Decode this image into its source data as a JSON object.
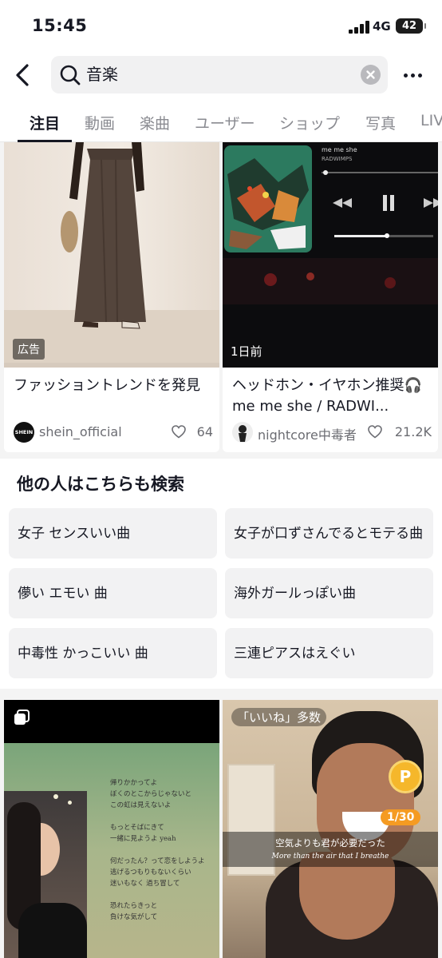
{
  "status_bar": {
    "time": "15:45",
    "network": "4G",
    "battery": "42"
  },
  "search": {
    "query": "音楽",
    "icons": {
      "back": "chevron-left-icon",
      "search": "search-icon",
      "clear": "clear-icon",
      "more": "more-icon"
    }
  },
  "tabs": [
    {
      "label": "注目",
      "active": true
    },
    {
      "label": "動画",
      "active": false
    },
    {
      "label": "楽曲",
      "active": false
    },
    {
      "label": "ユーザー",
      "active": false
    },
    {
      "label": "ショップ",
      "active": false
    },
    {
      "label": "写真",
      "active": false
    },
    {
      "label": "LIVE",
      "active": false
    }
  ],
  "feed": [
    {
      "badge": "広告",
      "title": "ファッショントレンドを発見",
      "author": "shein_official",
      "avatar_text": "SHEIN",
      "likes": "64"
    },
    {
      "badge": "1日前",
      "title": "ヘッドホン・イヤホン推奨🎧 me me she / RADWI...",
      "author": "nightcore中毒者",
      "likes": "21.2K",
      "player": {
        "song": "me me she",
        "artist": "RADWIMPS"
      }
    }
  ],
  "related": {
    "title": "他の人はこちらも検索",
    "items": [
      "女子 センスいい曲",
      "女子が口ずさんでるとモテる曲",
      "儚い エモい 曲",
      "海外ガールっぽい曲",
      "中毒性 かっこいい 曲",
      "三連ピアスはえぐい"
    ]
  },
  "bottom_cards": [
    {
      "lyrics": [
        "帰りかかってよ",
        "ぼくのとこからじゃないと",
        "この虹は見えないよ",
        "",
        "もっとそばにきて",
        "一緒に見ようよ yeah",
        "",
        "何だったん？って恋をしようよ",
        "逃げるつもりもないくらい",
        "迷いもなく 過ち冒して",
        "",
        "恐れたらきっと",
        "負けな気がして"
      ]
    },
    {
      "label": "「いいね」多数",
      "coin": "P",
      "counter": "1/30",
      "subtitle_jp": "空気よりも君が必要だった",
      "subtitle_en": "More than the air that I breathe"
    }
  ],
  "colors": {
    "text": "#161823",
    "muted": "#8a8b91",
    "chip_bg": "#f2f2f3",
    "coin": "#f5b72b",
    "counter": "#f59b22"
  }
}
